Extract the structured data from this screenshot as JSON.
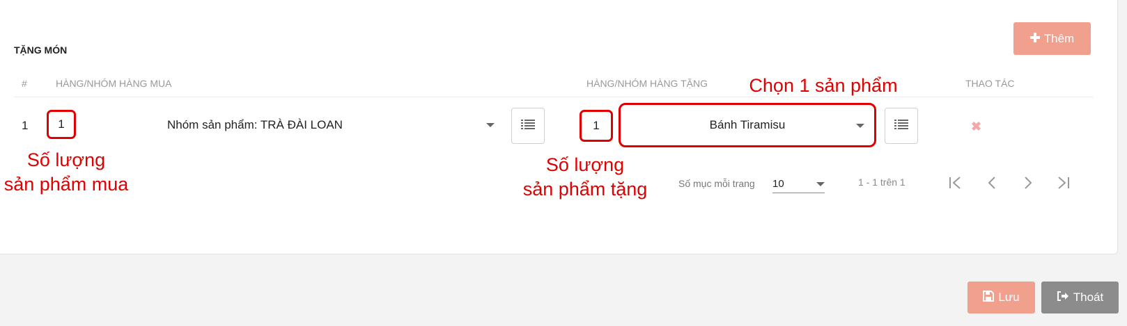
{
  "section": {
    "title": "TẶNG MÓN",
    "add_label": "Thêm"
  },
  "table": {
    "headers": {
      "index": "#",
      "buy_group": "HÀNG/NHÓM HÀNG MUA",
      "gift_group": "HÀNG/NHÓM HÀNG TẶNG",
      "actions": "THAO TÁC"
    },
    "rows": [
      {
        "index": "1",
        "buy_qty": "1",
        "buy_item": "Nhóm sản phẩm: TRÀ ĐÀI LOAN",
        "gift_qty": "1",
        "gift_item": "Bánh Tiramisu",
        "delete": "✖"
      }
    ]
  },
  "annotations": {
    "buy_qty_line1": "Số lượng",
    "buy_qty_line2": "sản phẩm mua",
    "gift_qty_line1": "Số lượng",
    "gift_qty_line2": "sản phẩm tặng",
    "choose_product": "Chọn 1 sản phẩm"
  },
  "pagination": {
    "per_page_label": "Số mục mỗi trang",
    "per_page_value": "10",
    "info": "1 - 1 trên 1"
  },
  "footer": {
    "save_label": "Lưu",
    "exit_label": "Thoát"
  },
  "colors": {
    "accent": "#f0a08c",
    "annotation": "#e00000",
    "exit": "#8c8c8c"
  }
}
